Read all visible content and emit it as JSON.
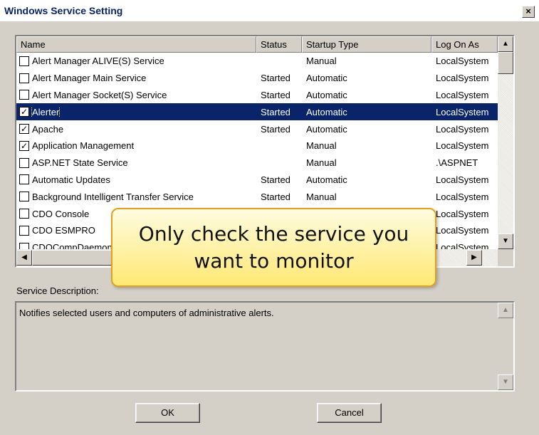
{
  "window": {
    "title": "Windows Service Setting",
    "close_glyph": "×"
  },
  "list": {
    "columns": [
      "Name",
      "Status",
      "Startup Type",
      "Log On As"
    ],
    "rows": [
      {
        "name": "Alert Manager ALIVE(S) Service",
        "status": "",
        "startup": "Manual",
        "logon": "LocalSystem",
        "checked": false,
        "selected": false
      },
      {
        "name": "Alert Manager Main Service",
        "status": "Started",
        "startup": "Automatic",
        "logon": "LocalSystem",
        "checked": false,
        "selected": false
      },
      {
        "name": "Alert Manager Socket(S) Service",
        "status": "Started",
        "startup": "Automatic",
        "logon": "LocalSystem",
        "checked": false,
        "selected": false
      },
      {
        "name": "Alerter",
        "status": "Started",
        "startup": "Automatic",
        "logon": "LocalSystem",
        "checked": true,
        "selected": true
      },
      {
        "name": "Apache",
        "status": "Started",
        "startup": "Automatic",
        "logon": "LocalSystem",
        "checked": true,
        "selected": false
      },
      {
        "name": "Application Management",
        "status": "",
        "startup": "Manual",
        "logon": "LocalSystem",
        "checked": true,
        "selected": false
      },
      {
        "name": "ASP.NET State Service",
        "status": "",
        "startup": "Manual",
        "logon": ".\\ASPNET",
        "checked": false,
        "selected": false
      },
      {
        "name": "Automatic Updates",
        "status": "Started",
        "startup": "Automatic",
        "logon": "LocalSystem",
        "checked": false,
        "selected": false
      },
      {
        "name": "Background Intelligent Transfer Service",
        "status": "Started",
        "startup": "Manual",
        "logon": "LocalSystem",
        "checked": false,
        "selected": false
      },
      {
        "name": "CDO Console",
        "status": "",
        "startup": "",
        "logon": "LocalSystem",
        "checked": false,
        "selected": false
      },
      {
        "name": "CDO ESMPRO",
        "status": "",
        "startup": "",
        "logon": "LocalSystem",
        "checked": false,
        "selected": false
      },
      {
        "name": "CDOCompDaemon",
        "status": "",
        "startup": "",
        "logon": "LocalSystem",
        "checked": false,
        "selected": false
      }
    ]
  },
  "callout": {
    "text": "Only check the service you want to monitor"
  },
  "description": {
    "label": "Service Description:",
    "text": "Notifies selected users and computers of administrative alerts."
  },
  "buttons": {
    "ok": "OK",
    "cancel": "Cancel"
  },
  "icons": {
    "check": "✓",
    "up": "▲",
    "down": "▼",
    "left": "◀",
    "right": "▶"
  }
}
